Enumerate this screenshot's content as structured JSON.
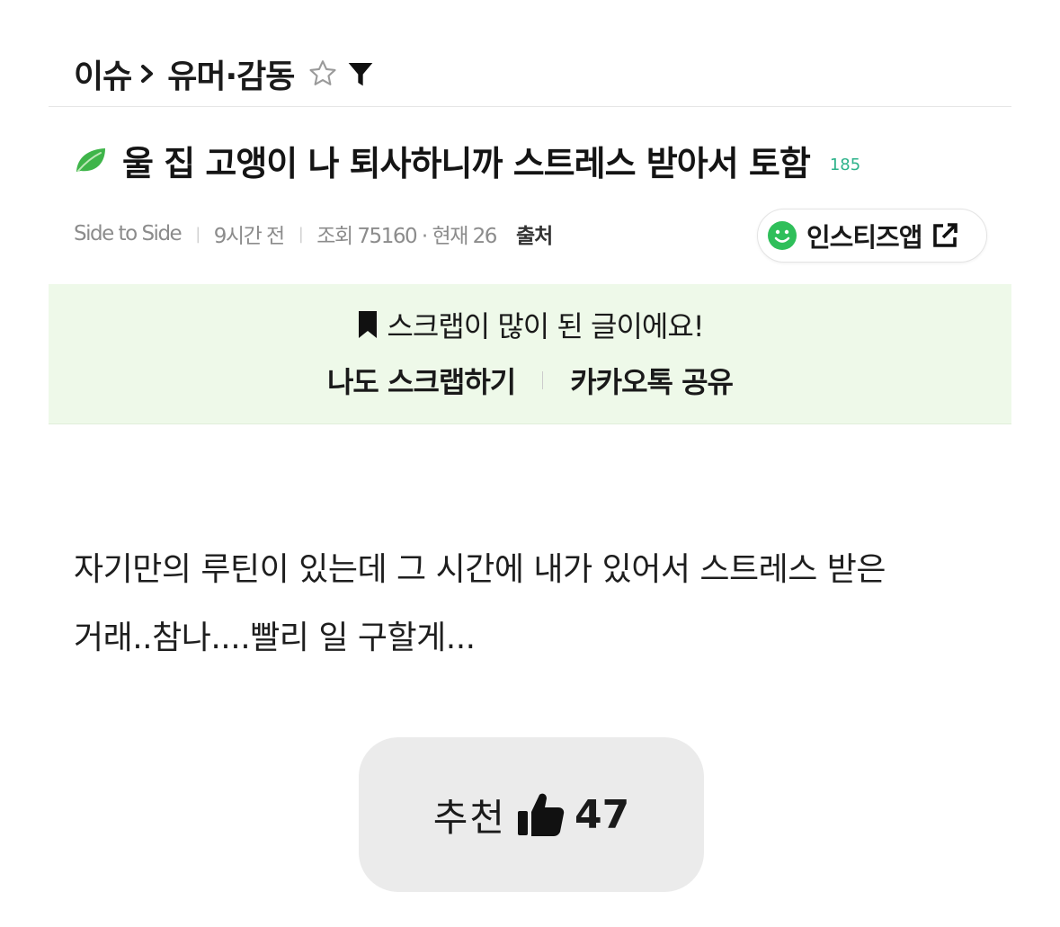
{
  "breadcrumb": {
    "section": "이슈",
    "category": "유머·감동"
  },
  "post": {
    "title": "울 집 고앵이 나 퇴사하니까 스트레스 받아서 토함",
    "comment_count": "185",
    "author": "Side to Side",
    "time": "9시간 전",
    "views": "조회 75160 · 현재 26",
    "source_label": "출처",
    "app_button_label": "인스티즈앱"
  },
  "scrap_banner": {
    "message": "스크랩이 많이 된 글이에요!",
    "scrap_action": "나도 스크랩하기",
    "share_action": "카카오톡 공유"
  },
  "body": {
    "line1": "자기만의 루틴이 있는데 그 시간에 내가 있어서 스트레스 받은",
    "line2": "거래..참나....빨리 일 구할게..."
  },
  "recommend": {
    "label": "추천",
    "count": "47"
  },
  "colors": {
    "accent_green": "#2db28a",
    "banner_bg": "#eef9e9",
    "button_bg": "#ebebeb"
  },
  "icons": [
    "chevron-right-icon",
    "star-outline-icon",
    "filter-icon",
    "leaf-icon",
    "smile-icon",
    "external-link-icon",
    "bookmark-icon",
    "thumbs-up-icon"
  ]
}
